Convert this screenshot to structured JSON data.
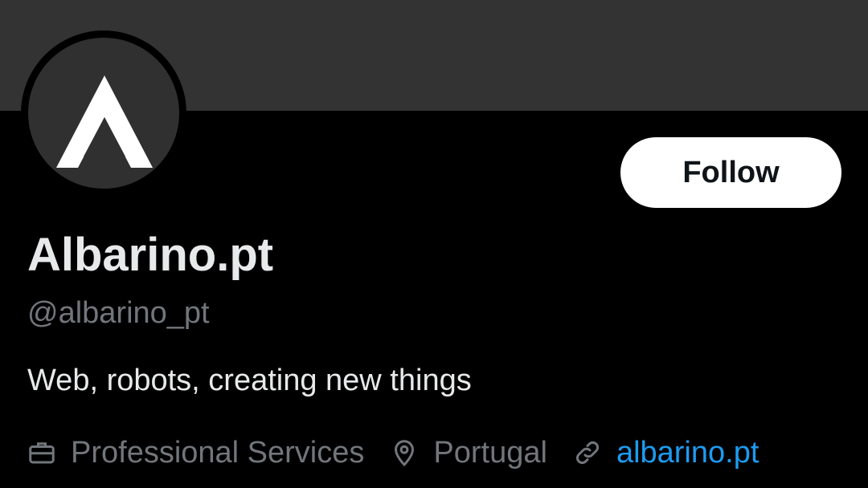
{
  "profile": {
    "display_name": "Albarino.pt",
    "handle": "@albarino_pt",
    "bio": "Web, robots, creating new things",
    "follow_label": "Follow",
    "category": "Professional Services",
    "location": "Portugal",
    "website": "albarino.pt"
  },
  "icons": {
    "category": "briefcase-icon",
    "location": "location-pin-icon",
    "website": "link-icon"
  },
  "colors": {
    "background": "#000000",
    "banner": "#333333",
    "primary_text": "#e7e9ea",
    "secondary_text": "#71767b",
    "link": "#1d9bf0",
    "follow_button_bg": "#ffffff"
  }
}
